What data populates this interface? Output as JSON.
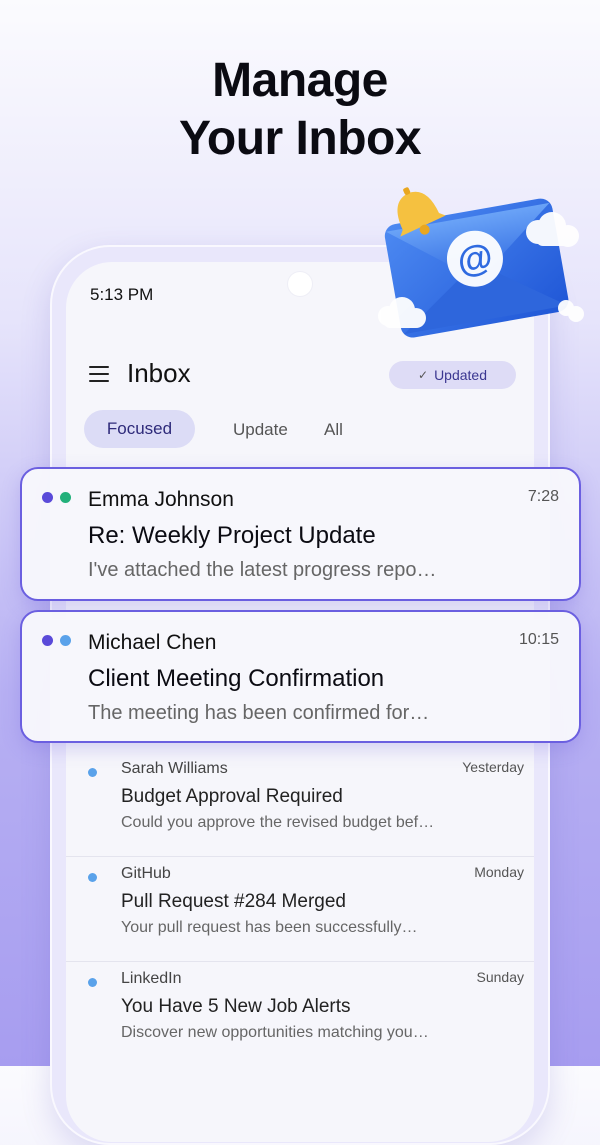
{
  "headline": {
    "line1": "Manage",
    "line2": "Your Inbox"
  },
  "status_bar": {
    "time": "5:13 PM"
  },
  "header": {
    "title": "Inbox",
    "updated_label": "Updated"
  },
  "tabs": [
    {
      "label": "Focused",
      "active": true
    },
    {
      "label": "Update",
      "active": false
    },
    {
      "label": "All",
      "active": false
    }
  ],
  "highlighted": [
    {
      "sender": "Emma Johnson",
      "time": "7:28",
      "subject": "Re: Weekly Project Update",
      "preview": "I've attached the latest progress repo…",
      "dot_colors": [
        "#5a4ad9",
        "#22b07a"
      ]
    },
    {
      "sender": "Michael Chen",
      "time": "10:15",
      "subject": "Client Meeting Confirmation",
      "preview": "The meeting has been confirmed for…",
      "dot_colors": [
        "#5a4ad9",
        "#5aa2ea"
      ]
    }
  ],
  "emails": [
    {
      "sender": "Sarah Williams",
      "time": "Yesterday",
      "subject": "Budget Approval Required",
      "preview": "Could you approve the revised budget bef…"
    },
    {
      "sender": "GitHub",
      "time": "Monday",
      "subject": "Pull Request #284 Merged",
      "preview": "Your pull request has been successfully…"
    },
    {
      "sender": "LinkedIn",
      "time": "Sunday",
      "subject": "You Have 5 New Job Alerts",
      "preview": "Discover new opportunities matching you…"
    }
  ],
  "colors": {
    "accent": "#6b5fe0",
    "pill_bg": "#dedcf6",
    "unread_dot": "#5aa2ea"
  }
}
